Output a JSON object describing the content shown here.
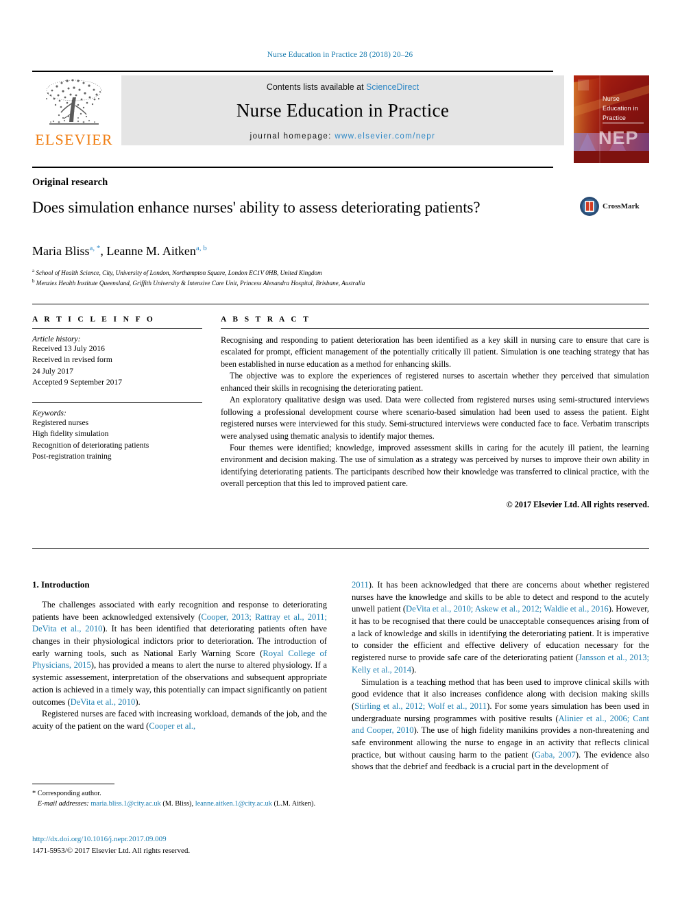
{
  "running_head": "Nurse Education in Practice 28 (2018) 20–26",
  "masthead": {
    "publisher": "ELSEVIER",
    "contents_prefix": "Contents lists available at ",
    "contents_link": "ScienceDirect",
    "journal_title": "Nurse Education in Practice",
    "homepage_prefix": "journal homepage: ",
    "homepage_url": "www.elsevier.com/nepr",
    "cover": {
      "line1": "Nurse",
      "line2": "Education in",
      "line3": "Practice",
      "acronym": "NEP"
    }
  },
  "article": {
    "type": "Original research",
    "title": "Does simulation enhance nurses' ability to assess deteriorating patients?",
    "authors": [
      {
        "name": "Maria Bliss",
        "marks": "a, *"
      },
      {
        "name": "Leanne M. Aitken",
        "marks": "a, b"
      }
    ],
    "authors_joiner": ", ",
    "affiliations": [
      {
        "mark": "a",
        "text": "School of Health Science, City, University of London, Northampton Square, London EC1V 0HB, United Kingdom"
      },
      {
        "mark": "b",
        "text": "Menzies Health Institute Queensland, Griffith University & Intensive Care Unit, Princess Alexandra Hospital, Brisbane, Australia"
      }
    ],
    "crossmark_label": "CrossMark"
  },
  "article_info": {
    "heading": "A R T I C L E   I N F O",
    "history_label": "Article history:",
    "history": [
      "Received 13 July 2016",
      "Received in revised form",
      "24 July 2017",
      "Accepted 9 September 2017"
    ],
    "keywords_label": "Keywords:",
    "keywords": [
      "Registered nurses",
      "High fidelity simulation",
      "Recognition of deteriorating patients",
      "Post-registration training"
    ]
  },
  "abstract": {
    "heading": "A B S T R A C T",
    "paragraphs": [
      "Recognising and responding to patient deterioration has been identified as a key skill in nursing care to ensure that care is escalated for prompt, efficient management of the potentially critically ill patient. Simulation is one teaching strategy that has been established in nurse education as a method for enhancing skills.",
      "The objective was to explore the experiences of registered nurses to ascertain whether they perceived that simulation enhanced their skills in recognising the deteriorating patient.",
      "An exploratory qualitative design was used. Data were collected from registered nurses using semi-structured interviews following a professional development course where scenario-based simulation had been used to assess the patient. Eight registered nurses were interviewed for this study. Semi-structured interviews were conducted face to face. Verbatim transcripts were analysed using thematic analysis to identify major themes.",
      "Four themes were identified; knowledge, improved assessment skills in caring for the acutely ill patient, the learning environment and decision making. The use of simulation as a strategy was perceived by nurses to improve their own ability in identifying deteriorating patients. The participants described how their knowledge was transferred to clinical practice, with the overall perception that this led to improved patient care."
    ],
    "copyright": "© 2017 Elsevier Ltd. All rights reserved."
  },
  "body": {
    "section_number_title": "1. Introduction",
    "left_paragraphs": [
      {
        "runs": [
          {
            "t": "The challenges associated with early recognition and response to deteriorating patients have been acknowledged extensively ("
          },
          {
            "t": "Cooper, 2013; Rattray et al., 2011; DeVita et al., 2010",
            "c": true
          },
          {
            "t": "). It has been identified that deteriorating patients often have changes in their physiological indictors prior to deterioration. The introduction of early warning tools, such as National Early Warning Score ("
          },
          {
            "t": "Royal College of Physicians, 2015",
            "c": true
          },
          {
            "t": "), has provided a means to alert the nurse to altered physiology. If a systemic assessement, interpretation of the observations and subsequent appropriate action is achieved in a timely way, this potentially can impact significantly on patient outcomes ("
          },
          {
            "t": "DeVita et al., 2010",
            "c": true
          },
          {
            "t": ")."
          }
        ]
      },
      {
        "runs": [
          {
            "t": "Registered nurses are faced with increasing workload, demands of the job, and the acuity of the patient on the ward ("
          },
          {
            "t": "Cooper et al.,",
            "c": true
          }
        ]
      }
    ],
    "right_paragraphs": [
      {
        "runs": [
          {
            "t": "2011",
            "c": true
          },
          {
            "t": "). It has been acknowledged that there are concerns about whether registered nurses have the knowledge and skills to be able to detect and respond to the acutely unwell patient ("
          },
          {
            "t": "DeVita et al., 2010; Askew et al., 2012; Waldie et al., 2016",
            "c": true
          },
          {
            "t": "). However, it has to be recognised that there could be unacceptable consequences arising from of a lack of knowledge and skills in identifying the deteroriating patient. It is imperative to consider the efficient and effective delivery of education necessary for the registered nurse to provide safe care of the deteriorating patient ("
          },
          {
            "t": "Jansson et al., 2013; Kelly et al., 2014",
            "c": true
          },
          {
            "t": ")."
          }
        ],
        "no_indent": true
      },
      {
        "runs": [
          {
            "t": "Simulation is a teaching method that has been used to improve clinical skills with good evidence that it also increases confidence along with decision making skills ("
          },
          {
            "t": "Stirling et al., 2012; Wolf et al., 2011",
            "c": true
          },
          {
            "t": "). For some years simulation has been used in undergraduate nursing programmes with positive results ("
          },
          {
            "t": "Alinier et al., 2006; Cant and Cooper, 2010",
            "c": true
          },
          {
            "t": "). The use of high fidelity manikins provides a non-threatening and safe environment allowing the nurse to engage in an activity that reflects clinical practice, but without causing harm to the patient ("
          },
          {
            "t": "Gaba, 2007",
            "c": true
          },
          {
            "t": "). The evidence also shows that the debrief and feedback is a crucial part in the development of"
          }
        ]
      }
    ]
  },
  "footnotes": {
    "corresponding": "* Corresponding author.",
    "email_label": "E-mail addresses:",
    "email1": "maria.bliss.1@city.ac.uk",
    "email1_attr": " (M. Bliss), ",
    "email2": "leanne.aitken.1@city.ac.uk",
    "email2_attr": " (L.M. Aitken).",
    "doi": "http://dx.doi.org/10.1016/j.nepr.2017.09.009",
    "issn_line": "1471-5953/© 2017 Elsevier Ltd. All rights reserved."
  },
  "colors": {
    "link": "#1a7db0",
    "science_direct": "#2b86c5",
    "elsevier_orange": "#f07e13",
    "cover_red": "#8c1410"
  }
}
